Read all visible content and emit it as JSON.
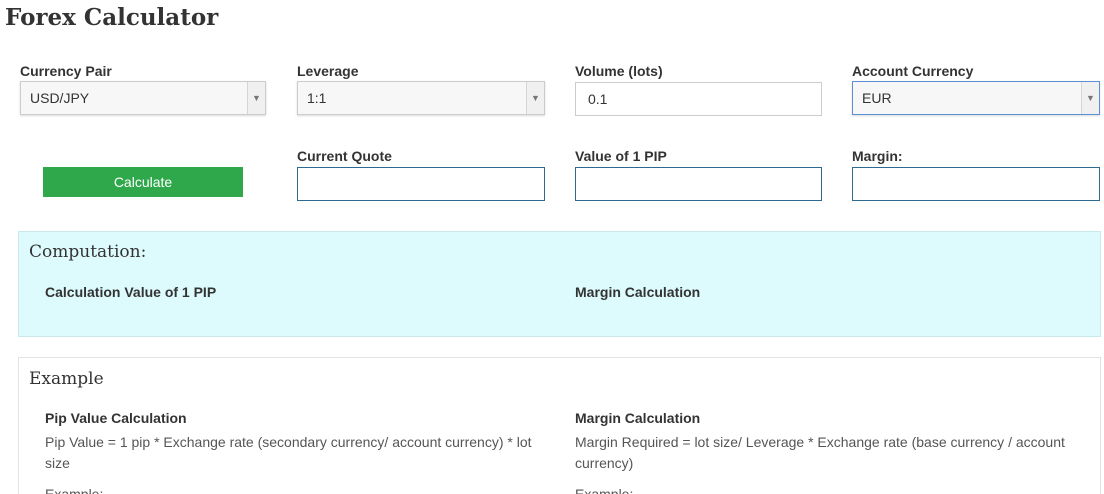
{
  "page": {
    "title": "Forex Calculator"
  },
  "form": {
    "currency_pair": {
      "label": "Currency Pair",
      "value": "USD/JPY"
    },
    "leverage": {
      "label": "Leverage",
      "value": "1:1"
    },
    "volume": {
      "label": "Volume (lots)",
      "value": "0.1"
    },
    "account_currency": {
      "label": "Account Currency",
      "value": "EUR"
    },
    "calculate_label": "Calculate",
    "current_quote": {
      "label": "Current Quote",
      "value": ""
    },
    "pip_value": {
      "label": "Value of 1 PIP",
      "value": ""
    },
    "margin": {
      "label": "Margin:",
      "value": ""
    }
  },
  "computation": {
    "title": "Computation:",
    "pip_heading": "Calculation Value of 1 PIP",
    "margin_heading": "Margin Calculation"
  },
  "example": {
    "title": "Example",
    "pip_heading": "Pip Value Calculation",
    "pip_formula": "Pip Value = 1 pip * Exchange rate (secondary currency/ account currency) * lot size",
    "pip_example_label": "Example:",
    "margin_heading": "Margin Calculation",
    "margin_formula": "Margin Required = lot size/ Leverage * Exchange rate (base currency / account currency)",
    "margin_example_label": "Example:"
  },
  "icons": {
    "dropdown": "chevron-down-icon"
  },
  "colors": {
    "button": "#2ea84a",
    "computation_bg": "#ddfbfc",
    "output_border": "#2e6a8e"
  }
}
